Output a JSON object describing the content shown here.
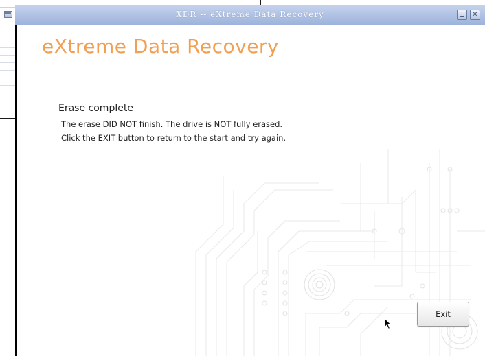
{
  "window": {
    "title": "XDR -- eXtreme Data Recovery"
  },
  "app": {
    "title": "eXtreme Data Recovery",
    "title_color": "#f0a050"
  },
  "message": {
    "heading": "Erase complete",
    "line1": "The erase DID NOT finish. The drive is NOT fully erased.",
    "line2": "Click the EXIT button to return to the start and try again."
  },
  "buttons": {
    "exit_label": "Exit"
  },
  "icons": {
    "window_menu": "window-menu-icon",
    "minimize": "minimize-icon",
    "close": "close-icon",
    "cursor": "mouse-pointer-icon"
  }
}
